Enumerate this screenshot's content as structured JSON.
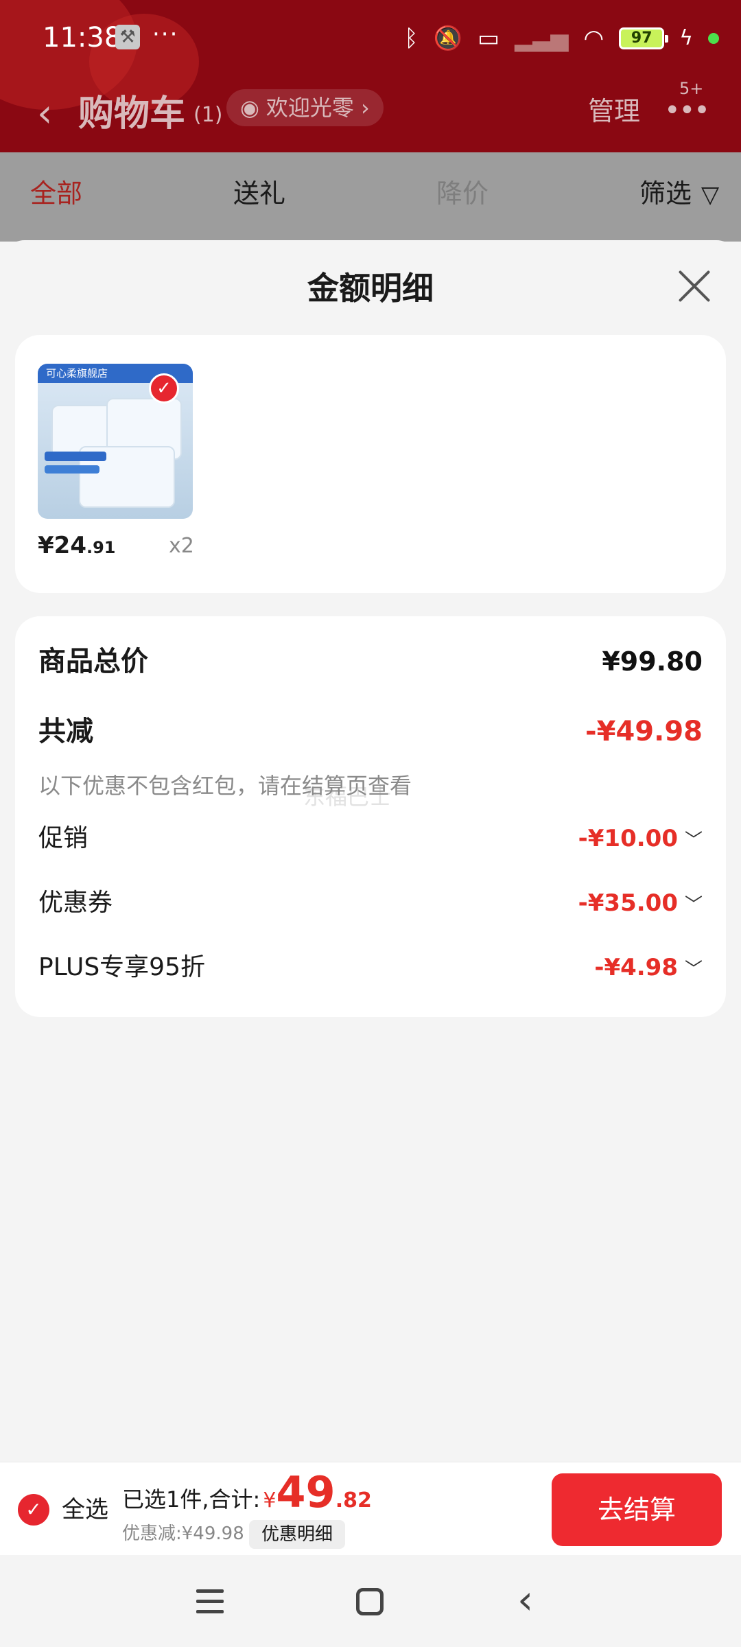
{
  "status_bar": {
    "time": "11:38",
    "dots": "···",
    "battery": "97",
    "icons": [
      "wrench-icon",
      "bluetooth-icon",
      "mute-icon",
      "laptop-icon",
      "signal-icon",
      "wifi-icon",
      "battery-icon",
      "charging-icon"
    ]
  },
  "header": {
    "title": "购物车",
    "count": "(1)",
    "welcome": "欢迎光零",
    "manage": "管理",
    "more_badge": "5+"
  },
  "tabs": [
    {
      "label": "全部",
      "active": true
    },
    {
      "label": "送礼",
      "active": false
    },
    {
      "label": "降价",
      "active": false
    },
    {
      "label": "筛选",
      "active": false
    }
  ],
  "sheet": {
    "title": "金额明细",
    "product": {
      "thumb_banner": "可心柔旗舰店",
      "price_int": "¥24",
      "price_dec": ".91",
      "qty": "x2"
    },
    "detail": {
      "total_label": "商品总价",
      "total_value": "¥99.80",
      "reduce_label": "共减",
      "reduce_value": "-¥49.98",
      "hint": "以下优惠不包含红包，请在结算页查看",
      "watermark": "东福巴士",
      "items": [
        {
          "label": "促销",
          "value": "-¥10.00"
        },
        {
          "label": "优惠券",
          "value": "-¥35.00"
        },
        {
          "label": "PLUS专享95折",
          "value": "-¥4.98"
        }
      ]
    }
  },
  "bottom_bar": {
    "select_all": "全选",
    "selected_text": "已选1件,合计:",
    "currency": "¥",
    "total_int": "49",
    "total_dec": ".82",
    "discount_text": "优惠减:¥49.98",
    "discount_button": "优惠明细",
    "checkout": "去结算"
  },
  "colors": {
    "brand_red": "#e62e27",
    "header_bg": "#8a0812",
    "checkout_bg": "#ee2a30"
  }
}
